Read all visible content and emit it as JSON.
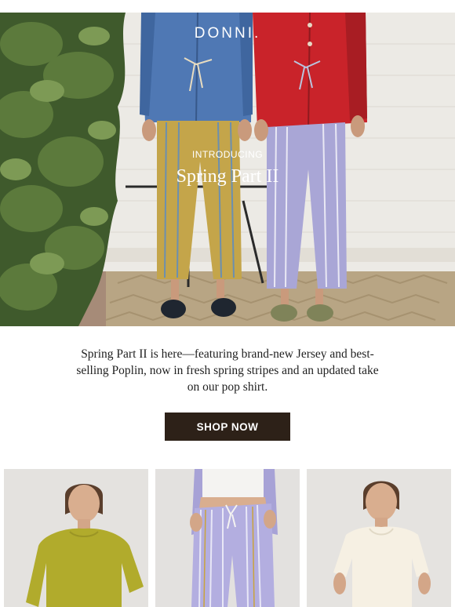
{
  "brand": {
    "logo_text": "DONNI."
  },
  "hero": {
    "eyebrow": "INTRODUCING",
    "headline": "Spring Part II"
  },
  "body": {
    "text": "Spring Part II is here—featuring brand-new Jersey and best-selling Poplin, now in fresh spring stripes and an updated take on our pop shirt."
  },
  "cta": {
    "label": "SHOP NOW"
  },
  "colors": {
    "cta_background": "#2d2118",
    "cta_text": "#ffffff",
    "body_text": "#1f1f1f"
  },
  "products": [
    {
      "image": "model in olive-yellow long-sleeve jersey top"
    },
    {
      "image": "model in lavender striped poplin pants with white tank"
    },
    {
      "image": "model in cream short-sleeve tee"
    }
  ]
}
